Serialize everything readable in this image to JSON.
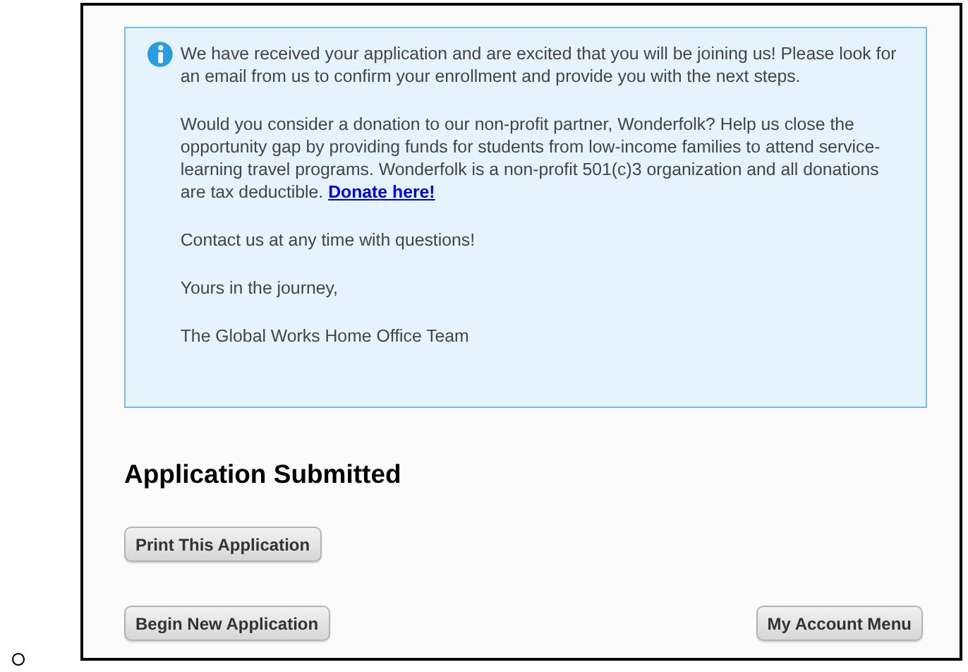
{
  "message": {
    "paragraphs": [
      {
        "text": "We have received your application and are excited that you will be joining us! Please look for an email from us to confirm your enrollment and provide you with the next steps."
      },
      {
        "text": "Would you consider a donation to our non-profit partner, Wonderfolk? Help us close the opportunity gap by providing funds for students from low-income families to attend service-learning travel programs. Wonderfolk is a non-profit 501(c)3 organization and all donations are tax deductible.",
        "link": "Donate here!"
      },
      {
        "text": "Contact us at any time with questions!"
      },
      {
        "text": "Yours in the journey,"
      },
      {
        "text": "The Global Works Home Office Team"
      }
    ]
  },
  "heading": "Application Submitted",
  "print_button": "Print This Application",
  "begin_button": "Begin New Application",
  "account_button": "My Account Menu"
}
